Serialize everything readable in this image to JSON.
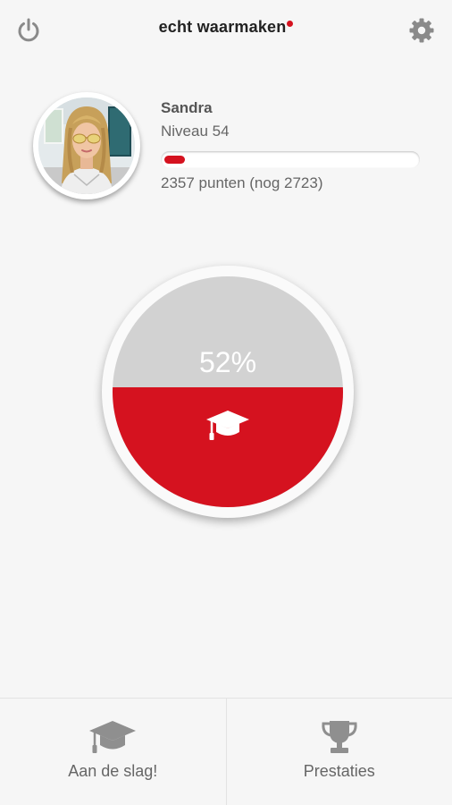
{
  "header": {
    "brand": "echt waarmaken",
    "power_icon": "power-icon",
    "settings_icon": "gear-icon"
  },
  "profile": {
    "name": "Sandra",
    "level": "Niveau 54",
    "points": "2357 punten (nog 2723)",
    "progress_fraction": 0.08
  },
  "gauge": {
    "percent_label": "52%",
    "percent_value": 52,
    "icon": "graduation-cap-icon"
  },
  "nav": {
    "items": [
      {
        "label": "Aan de slag!",
        "icon": "graduation-cap-icon"
      },
      {
        "label": "Prestaties",
        "icon": "trophy-icon"
      }
    ]
  },
  "colors": {
    "accent": "#d5121f",
    "gauge_empty": "#d2d2d2",
    "background": "#f6f6f6"
  }
}
